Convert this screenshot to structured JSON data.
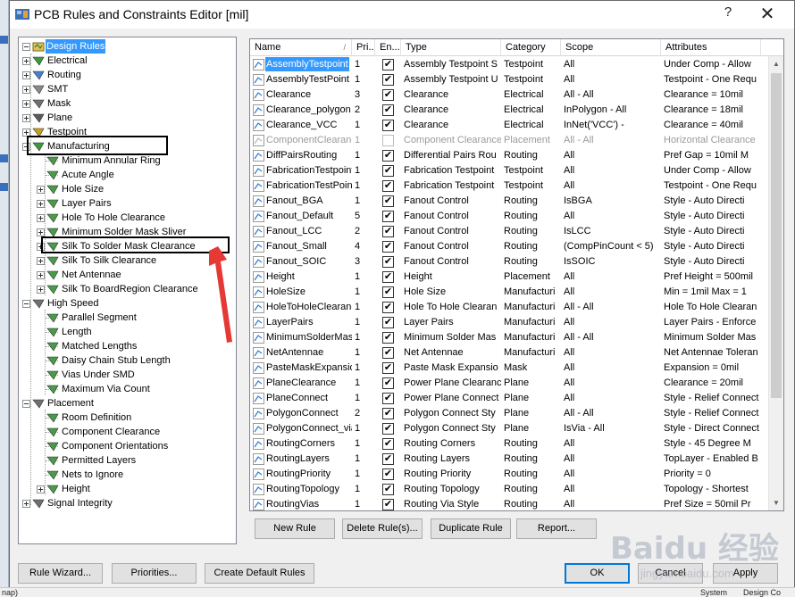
{
  "window": {
    "title": "PCB Rules and Constraints Editor [mil]",
    "help": "?",
    "close": "✕"
  },
  "tree": {
    "root": "Design Rules",
    "nodes": [
      {
        "label": "Electrical",
        "icon": "electrical-rule-icon"
      },
      {
        "label": "Routing",
        "icon": "routing-rule-icon"
      },
      {
        "label": "SMT",
        "icon": "smt-rule-icon"
      },
      {
        "label": "Mask",
        "icon": "mask-rule-icon"
      },
      {
        "label": "Plane",
        "icon": "plane-rule-icon"
      },
      {
        "label": "Testpoint",
        "icon": "testpoint-rule-icon"
      },
      {
        "label": "Manufacturing",
        "icon": "manufacturing-rule-icon"
      },
      {
        "label": "Minimum Annular Ring"
      },
      {
        "label": "Acute Angle"
      },
      {
        "label": "Hole Size"
      },
      {
        "label": "Layer Pairs"
      },
      {
        "label": "Hole To Hole Clearance"
      },
      {
        "label": "Minimum Solder Mask Sliver"
      },
      {
        "label": "Silk To Solder Mask Clearance"
      },
      {
        "label": "Silk To Silk Clearance"
      },
      {
        "label": "Net Antennae"
      },
      {
        "label": "Silk To BoardRegion Clearance"
      },
      {
        "label": "High Speed"
      },
      {
        "label": "Parallel Segment"
      },
      {
        "label": "Length"
      },
      {
        "label": "Matched Lengths"
      },
      {
        "label": "Daisy Chain Stub Length"
      },
      {
        "label": "Vias Under SMD"
      },
      {
        "label": "Maximum Via Count"
      },
      {
        "label": "Placement"
      },
      {
        "label": "Room Definition"
      },
      {
        "label": "Component Clearance"
      },
      {
        "label": "Component Orientations"
      },
      {
        "label": "Permitted Layers"
      },
      {
        "label": "Nets to Ignore"
      },
      {
        "label": "Height"
      },
      {
        "label": "Signal Integrity"
      }
    ]
  },
  "grid": {
    "columns": [
      "Name",
      "Pri...",
      "En...",
      "Type",
      "Category",
      "Scope",
      "Attributes"
    ],
    "sort_indicator": "/",
    "rows": [
      {
        "name": "AssemblyTestpoint",
        "pri": "1",
        "en": true,
        "type": "Assembly Testpoint S",
        "category": "Testpoint",
        "scope": "All",
        "attrs": "Under Comp - Allow"
      },
      {
        "name": "AssemblyTestPoint",
        "pri": "1",
        "en": true,
        "type": "Assembly Testpoint U",
        "category": "Testpoint",
        "scope": "All",
        "attrs": "Testpoint - One Requ"
      },
      {
        "name": "Clearance",
        "pri": "3",
        "en": true,
        "type": "Clearance",
        "category": "Electrical",
        "scope": "All    -    All",
        "attrs": "Clearance = 10mil"
      },
      {
        "name": "Clearance_polygon",
        "pri": "2",
        "en": true,
        "type": "Clearance",
        "category": "Electrical",
        "scope": "InPolygon    -    All",
        "attrs": "Clearance = 18mil"
      },
      {
        "name": "Clearance_VCC",
        "pri": "1",
        "en": true,
        "type": "Clearance",
        "category": "Electrical",
        "scope": "InNet('VCC')    -",
        "attrs": "Clearance = 40mil"
      },
      {
        "name": "ComponentClearance",
        "pri": "1",
        "en": false,
        "type": "Component Clearance",
        "category": "Placement",
        "scope": "All    -    All",
        "attrs": "Horizontal Clearance"
      },
      {
        "name": "DiffPairsRouting",
        "pri": "1",
        "en": true,
        "type": "Differential Pairs Rou",
        "category": "Routing",
        "scope": "All",
        "attrs": "Pref Gap = 10mil    M"
      },
      {
        "name": "FabricationTestpoint",
        "pri": "1",
        "en": true,
        "type": "Fabrication Testpoint",
        "category": "Testpoint",
        "scope": "All",
        "attrs": "Under Comp - Allow"
      },
      {
        "name": "FabricationTestPoint",
        "pri": "1",
        "en": true,
        "type": "Fabrication Testpoint",
        "category": "Testpoint",
        "scope": "All",
        "attrs": "Testpoint - One Requ"
      },
      {
        "name": "Fanout_BGA",
        "pri": "1",
        "en": true,
        "type": "Fanout Control",
        "category": "Routing",
        "scope": "IsBGA",
        "attrs": "Style - Auto    Directi"
      },
      {
        "name": "Fanout_Default",
        "pri": "5",
        "en": true,
        "type": "Fanout Control",
        "category": "Routing",
        "scope": "All",
        "attrs": "Style - Auto    Directi"
      },
      {
        "name": "Fanout_LCC",
        "pri": "2",
        "en": true,
        "type": "Fanout Control",
        "category": "Routing",
        "scope": "IsLCC",
        "attrs": "Style - Auto    Directi"
      },
      {
        "name": "Fanout_Small",
        "pri": "4",
        "en": true,
        "type": "Fanout Control",
        "category": "Routing",
        "scope": "(CompPinCount < 5)",
        "attrs": "Style - Auto    Directi"
      },
      {
        "name": "Fanout_SOIC",
        "pri": "3",
        "en": true,
        "type": "Fanout Control",
        "category": "Routing",
        "scope": "IsSOIC",
        "attrs": "Style - Auto    Directi"
      },
      {
        "name": "Height",
        "pri": "1",
        "en": true,
        "type": "Height",
        "category": "Placement",
        "scope": "All",
        "attrs": "Pref Height = 500mil"
      },
      {
        "name": "HoleSize",
        "pri": "1",
        "en": true,
        "type": "Hole Size",
        "category": "Manufacturi",
        "scope": "All",
        "attrs": "Min = 1mil    Max = 1"
      },
      {
        "name": "HoleToHoleClearance",
        "pri": "1",
        "en": true,
        "type": "Hole To Hole Clearan",
        "category": "Manufacturi",
        "scope": "All    -    All",
        "attrs": "Hole To Hole Clearan"
      },
      {
        "name": "LayerPairs",
        "pri": "1",
        "en": true,
        "type": "Layer Pairs",
        "category": "Manufacturi",
        "scope": "All",
        "attrs": "Layer Pairs - Enforce"
      },
      {
        "name": "MinimumSolderMaskSliver",
        "pri": "1",
        "en": true,
        "type": "Minimum Solder Mas",
        "category": "Manufacturi",
        "scope": "All    -    All",
        "attrs": "Minimum Solder Mas"
      },
      {
        "name": "NetAntennae",
        "pri": "1",
        "en": true,
        "type": "Net Antennae",
        "category": "Manufacturi",
        "scope": "All",
        "attrs": "Net Antennae Toleran"
      },
      {
        "name": "PasteMaskExpansion",
        "pri": "1",
        "en": true,
        "type": "Paste Mask Expansio",
        "category": "Mask",
        "scope": "All",
        "attrs": "Expansion = 0mil"
      },
      {
        "name": "PlaneClearance",
        "pri": "1",
        "en": true,
        "type": "Power Plane Clearanc",
        "category": "Plane",
        "scope": "All",
        "attrs": "Clearance = 20mil"
      },
      {
        "name": "PlaneConnect",
        "pri": "1",
        "en": true,
        "type": "Power Plane Connect",
        "category": "Plane",
        "scope": "All",
        "attrs": "Style - Relief Connect"
      },
      {
        "name": "PolygonConnect",
        "pri": "2",
        "en": true,
        "type": "Polygon Connect Sty",
        "category": "Plane",
        "scope": "All    -    All",
        "attrs": "Style - Relief Connect"
      },
      {
        "name": "PolygonConnect_via",
        "pri": "1",
        "en": true,
        "type": "Polygon Connect Sty",
        "category": "Plane",
        "scope": "IsVia    -    All",
        "attrs": "Style - Direct Connect"
      },
      {
        "name": "RoutingCorners",
        "pri": "1",
        "en": true,
        "type": "Routing Corners",
        "category": "Routing",
        "scope": "All",
        "attrs": "Style - 45 Degree    M"
      },
      {
        "name": "RoutingLayers",
        "pri": "1",
        "en": true,
        "type": "Routing Layers",
        "category": "Routing",
        "scope": "All",
        "attrs": "TopLayer - Enabled B"
      },
      {
        "name": "RoutingPriority",
        "pri": "1",
        "en": true,
        "type": "Routing Priority",
        "category": "Routing",
        "scope": "All",
        "attrs": "Priority = 0"
      },
      {
        "name": "RoutingTopology",
        "pri": "1",
        "en": true,
        "type": "Routing Topology",
        "category": "Routing",
        "scope": "All",
        "attrs": "Topology - Shortest"
      },
      {
        "name": "RoutingVias",
        "pri": "1",
        "en": true,
        "type": "Routing Via Style",
        "category": "Routing",
        "scope": "All",
        "attrs": "Pref Size = 50mil    Pr"
      }
    ]
  },
  "grid_buttons": {
    "new_rule": "New Rule",
    "delete_rule": "Delete Rule(s)...",
    "duplicate_rule": "Duplicate Rule",
    "report": "Report..."
  },
  "bottom_buttons": {
    "rule_wizard": "Rule Wizard...",
    "priorities": "Priorities...",
    "create_default": "Create Default Rules",
    "ok": "OK",
    "cancel": "Cancel",
    "apply": "Apply"
  },
  "watermark": {
    "big": "Baidu 经验",
    "small": "jingyan.baidu.com"
  },
  "status": {
    "left": "nap)",
    "system": "System",
    "design": "Design Co"
  },
  "colors": {
    "selection": "#3399ff",
    "default_button_border": "#0078d7",
    "annotation_arrow": "#e53935"
  }
}
